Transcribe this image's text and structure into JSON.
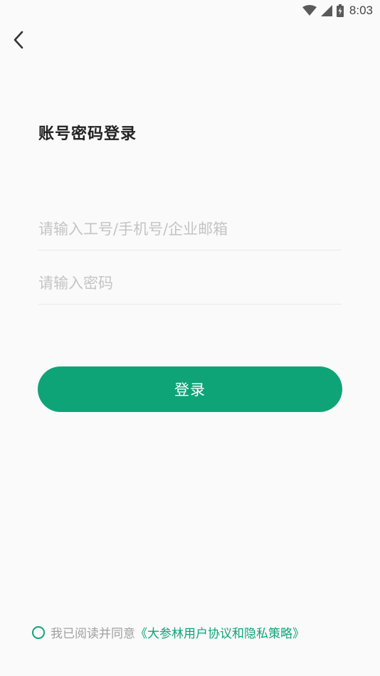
{
  "status_bar": {
    "time": "8:03",
    "icons": [
      "wifi-icon",
      "cellular-signal-icon",
      "battery-charging-icon"
    ]
  },
  "header": {
    "back_icon": "chevron-left-icon"
  },
  "main": {
    "title": "账号密码登录",
    "account_field": {
      "placeholder": "请输入工号/手机号/企业邮箱",
      "value": ""
    },
    "password_field": {
      "placeholder": "请输入密码",
      "value": ""
    },
    "login_button": "登录"
  },
  "agreement": {
    "checked": false,
    "text": "我已阅读并同意",
    "link": "《大参林用户协议和隐私策略》"
  },
  "colors": {
    "accent": "#0fa478",
    "background": "#fafafa",
    "placeholder": "#c4c4c4"
  }
}
